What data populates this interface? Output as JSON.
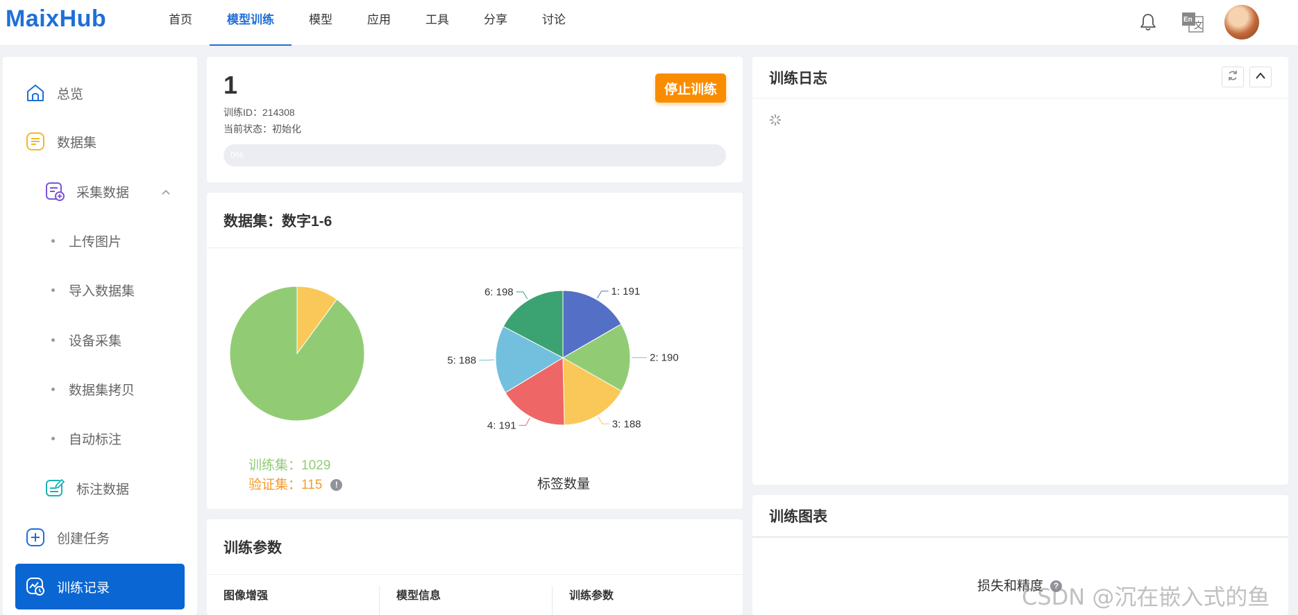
{
  "app": {
    "logo": "MaixHub"
  },
  "nav": {
    "items": [
      {
        "label": "首页"
      },
      {
        "label": "模型训练"
      },
      {
        "label": "模型"
      },
      {
        "label": "应用"
      },
      {
        "label": "工具"
      },
      {
        "label": "分享"
      },
      {
        "label": "讨论"
      }
    ],
    "active": "模型训练",
    "icons": [
      "bell-icon",
      "translate-icon"
    ],
    "translate_badge": "En"
  },
  "sidebar": {
    "items": [
      {
        "label": "总览",
        "icon": "home-icon"
      },
      {
        "label": "数据集",
        "icon": "dataset-icon"
      },
      {
        "label": "采集数据",
        "icon": "collect-icon"
      },
      {
        "label": "上传图片"
      },
      {
        "label": "导入数据集"
      },
      {
        "label": "设备采集"
      },
      {
        "label": "数据集拷贝"
      },
      {
        "label": "自动标注"
      },
      {
        "label": "标注数据",
        "icon": "annotate-icon"
      },
      {
        "label": "创建任务",
        "icon": "plus-icon"
      },
      {
        "label": "训练记录",
        "icon": "record-icon"
      }
    ],
    "active": "训练记录"
  },
  "task": {
    "number": "1",
    "id_line": "训练ID：214308",
    "status_line": "当前状态：初始化",
    "stop_label": "停止训练",
    "progress": 0,
    "progress_label": "0%"
  },
  "dataset": {
    "title": "数据集：数字1-6",
    "train_label": "训练集：1029",
    "valid_label": "验证集：115",
    "info_glyph": "!",
    "label_caption": "标签数量"
  },
  "chart_data": [
    {
      "type": "pie",
      "categories": [
        "训练集",
        "验证集"
      ],
      "values": [
        1029,
        115
      ],
      "colors": [
        "#91cc75",
        "#fac858"
      ]
    },
    {
      "type": "pie",
      "title": "标签数量",
      "categories": [
        "1",
        "2",
        "3",
        "4",
        "5",
        "6"
      ],
      "values": [
        191,
        190,
        188,
        191,
        188,
        198
      ],
      "labels": [
        "1: 191",
        "2: 190",
        "3: 188",
        "4: 191",
        "5: 188",
        "6: 198"
      ],
      "colors": [
        "#5470c6",
        "#91cc75",
        "#fac858",
        "#ee6666",
        "#73c0de",
        "#3ba272"
      ]
    }
  ],
  "params": {
    "title": "训练参数",
    "columns": [
      "图像增强",
      "模型信息",
      "训练参数"
    ]
  },
  "log": {
    "title": "训练日志"
  },
  "charts": {
    "title": "训练图表",
    "loss_title": "损失和精度",
    "help_glyph": "?"
  },
  "watermark": "CSDN @沉在嵌入式的鱼",
  "colors": {
    "accent": "#1f6fd8",
    "active_bg": "#0a66d3",
    "stop": "#fa8c00"
  }
}
